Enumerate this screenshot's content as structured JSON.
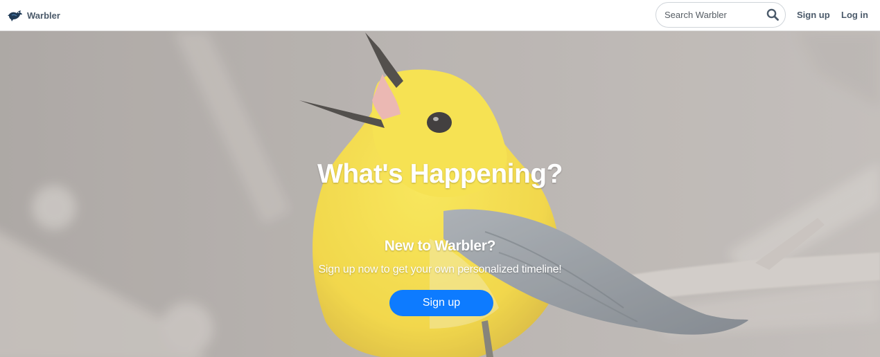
{
  "navbar": {
    "brand_name": "Warbler",
    "brand_icon": "warbler-bird-icon",
    "search": {
      "placeholder": "Search Warbler",
      "value": "",
      "button_icon": "search-icon"
    },
    "signup_label": "Sign up",
    "login_label": "Log in"
  },
  "hero": {
    "title": "What's Happening?",
    "subtitle": "New to Warbler?",
    "text": "Sign up now to get your own personalized timeline!",
    "button_label": "Sign up",
    "background_image": "yellow-warbler-bird-photo"
  },
  "colors": {
    "nav_text": "#4b5a6a",
    "primary_button": "#0d7bff",
    "bird_yellow": "#f2d630",
    "bird_gray": "#8a9099",
    "background_blur": "#a8a29e"
  }
}
